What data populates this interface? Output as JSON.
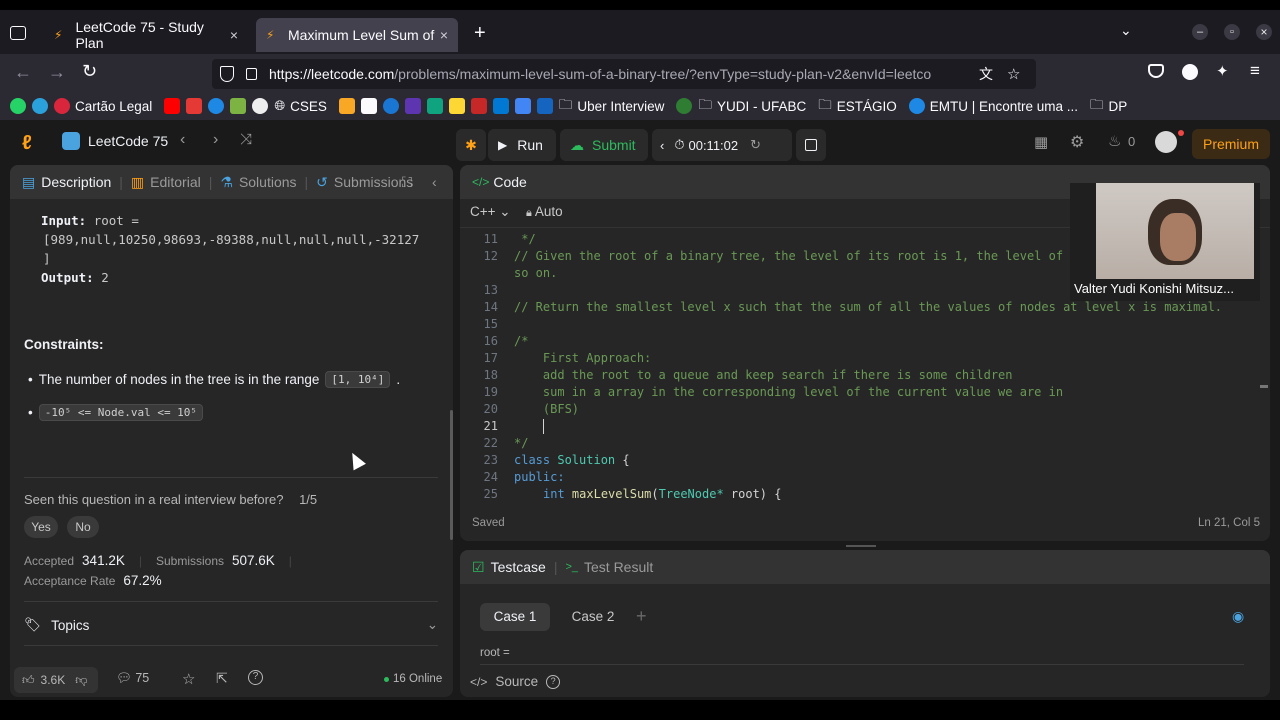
{
  "browser": {
    "tabs": [
      {
        "title": "LeetCode 75 - Study Plan",
        "close": "×"
      },
      {
        "title": "Maximum Level Sum of a",
        "close": "×"
      }
    ],
    "new_tab": "+",
    "url_host": "https://leetcode.com",
    "url_path": "/problems/maximum-level-sum-of-a-binary-tree/?envType=study-plan-v2&envId=leetco",
    "bookmarks": [
      "Cartão Legal",
      "CSES",
      "Uber Interview",
      "YUDI - UFABC",
      "ESTÁGIO",
      "EMTU | Encontre uma ...",
      "DP"
    ],
    "window_controls": [
      "–",
      "▫",
      "×"
    ]
  },
  "header": {
    "list_title": "LeetCode 75",
    "run": "Run",
    "submit": "Submit",
    "timer": "00:11:02",
    "fire_count": "0",
    "premium": "Premium"
  },
  "left": {
    "tabs": [
      "Description",
      "Editorial",
      "Solutions",
      "Submissions"
    ],
    "input_label": "Input:",
    "input_value_1": "root =",
    "input_value_2": "[989,null,10250,98693,-89388,null,null,null,-32127",
    "input_value_3": "]",
    "output_label": "Output:",
    "output_value": "2",
    "constraints_title": "Constraints:",
    "constraint1_text": "The number of nodes in the tree is in the range",
    "constraint1_code": "[1, 10⁴]",
    "constraint1_end": ".",
    "constraint2_code": "-10⁵ <= Node.val <= 10⁵",
    "seen_question": "Seen this question in a real interview before?",
    "seen_progress": "1/5",
    "yes": "Yes",
    "no": "No",
    "accepted_label": "Accepted",
    "accepted_value": "341.2K",
    "submissions_label": "Submissions",
    "submissions_value": "507.6K",
    "rate_label": "Acceptance Rate",
    "rate_value": "67.2%",
    "topics": "Topics",
    "likes": "3.6K",
    "comments": "75",
    "online": "16 Online"
  },
  "code": {
    "title": "Code",
    "language": "C++",
    "auto": "Auto",
    "status": "Saved",
    "cursor": "Ln 21, Col 5",
    "lines": [
      {
        "n": "11",
        "t": " */"
      },
      {
        "n": "12",
        "t": "// Given the root of a binary tree, the level of its root is 1, the level of"
      },
      {
        "n": "",
        "t": "so on."
      },
      {
        "n": "13",
        "t": ""
      },
      {
        "n": "14",
        "t": "// Return the smallest level x such that the sum of all the values of nodes at level x is maximal."
      },
      {
        "n": "15",
        "t": ""
      },
      {
        "n": "16",
        "t": "/*"
      },
      {
        "n": "17",
        "t": "    First Approach:"
      },
      {
        "n": "18",
        "t": "    add the root to a queue and keep search if there is some children"
      },
      {
        "n": "19",
        "t": "    sum in a array in the corresponding level of the current value we are in"
      },
      {
        "n": "20",
        "t": "    (BFS)"
      },
      {
        "n": "21",
        "t": "    "
      },
      {
        "n": "22",
        "t": "*/"
      },
      {
        "n": "23",
        "t": ""
      },
      {
        "n": "24",
        "t": ""
      },
      {
        "n": "25",
        "t": ""
      }
    ],
    "line23_kw": "class",
    "line23_ty": "Solution",
    "line23_br": "{",
    "line24": "public:",
    "line25_kw": "int",
    "line25_fn": "maxLevelSum",
    "line25_ty": "TreeNode*",
    "line25_rest": "root) {"
  },
  "webcam": {
    "caption": "Valter Yudi Konishi Mitsuz..."
  },
  "testcase": {
    "tab1": "Testcase",
    "tab2": "Test Result",
    "case1": "Case 1",
    "case2": "Case 2",
    "add": "+",
    "root_label": "root =",
    "source": "Source"
  },
  "colors": {
    "accent_green": "#2cbb5d",
    "premium": "#ffa116",
    "brand_orange": "#ffa116"
  }
}
